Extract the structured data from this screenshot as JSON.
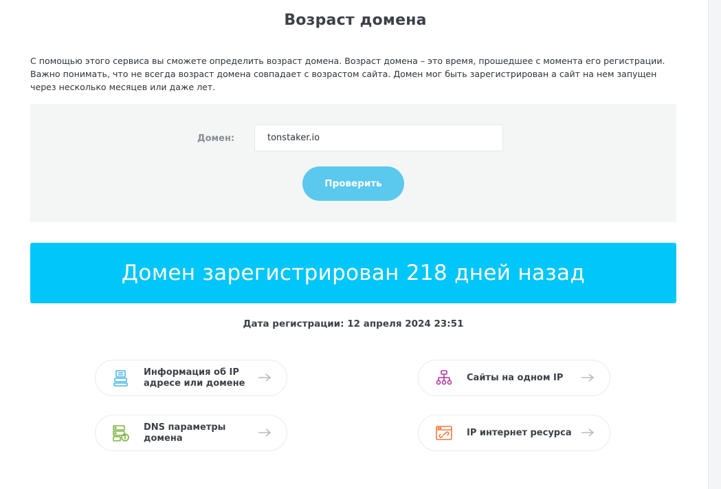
{
  "page": {
    "title": "Возраст домена",
    "description": "С помощью этого сервиса вы сможете определить возраст домена. Возраст домена – это время, прошедшее с момента его регистрации. Важно понимать, что не всегда возраст домена совпадает с возрастом сайта. Домен мог быть зарегистрирован а сайт на нем запущен через несколько месяцев или даже лет."
  },
  "form": {
    "domain_label": "Домен:",
    "domain_value": "tonstaker.io",
    "submit_label": "Проверить"
  },
  "result": {
    "banner_text": "Домен зарегистрирован 218 дней назад",
    "registration_date": "Дата регистрации: 12 апреля 2024 23:51"
  },
  "links": [
    {
      "label": "Информация об IP адресе или домене",
      "icon": "server-info-icon",
      "color": "#4ab6e6"
    },
    {
      "label": "Сайты на одном IP",
      "icon": "sitemap-icon",
      "color": "#b03aa3"
    },
    {
      "label": "DNS параметры домена",
      "icon": "dns-settings-icon",
      "color": "#7cb342"
    },
    {
      "label": "IP интернет ресурса",
      "icon": "browser-link-icon",
      "color": "#f07a3c"
    }
  ],
  "colors": {
    "accent": "#00c6f9",
    "button": "#5bc8ee",
    "panel": "#f4f6f6"
  }
}
